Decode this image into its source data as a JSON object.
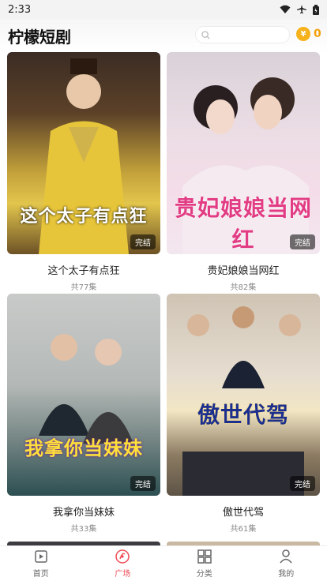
{
  "status": {
    "time": "2:33"
  },
  "header": {
    "title": "柠檬短剧",
    "coins": "0"
  },
  "cards": [
    {
      "title": "这个太子有点狂",
      "episodes": "共77集",
      "badge": "完结",
      "poster_text": "这个太子有点狂"
    },
    {
      "title": "贵妃娘娘当网红",
      "episodes": "共82集",
      "badge": "完结",
      "poster_text": "贵妃娘娘当网红"
    },
    {
      "title": "我拿你当妹妹",
      "episodes": "共33集",
      "badge": "完结",
      "poster_text": "我拿你当妹妹"
    },
    {
      "title": "傲世代驾",
      "episodes": "共61集",
      "badge": "完结",
      "poster_text": "傲世代驾"
    }
  ],
  "nav": [
    {
      "label": "首页",
      "icon": "home-icon",
      "active": false
    },
    {
      "label": "广场",
      "icon": "square-icon",
      "active": true
    },
    {
      "label": "分类",
      "icon": "grid-icon",
      "active": false
    },
    {
      "label": "我的",
      "icon": "user-icon",
      "active": false
    }
  ],
  "colors": {
    "accent": "#f24a56",
    "coin": "#f3a10b"
  }
}
